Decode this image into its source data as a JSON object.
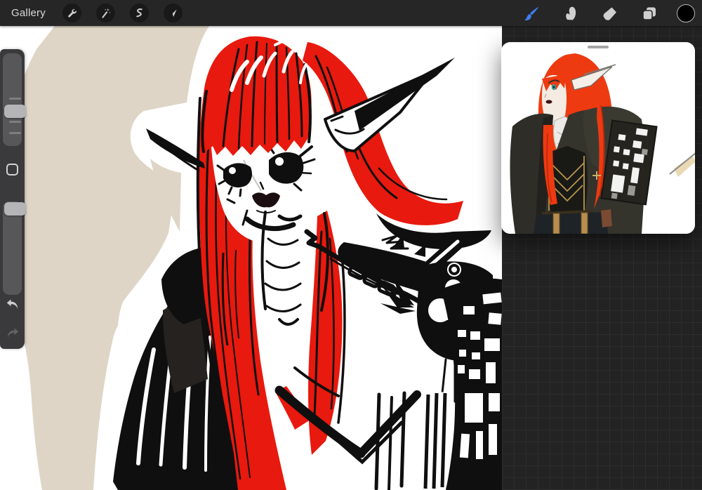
{
  "app_title": "Procreate canvas workspace",
  "toolbar": {
    "gallery_label": "Gallery",
    "left_tools": [
      {
        "id": "actions",
        "label": "Actions",
        "icon": "wrench-icon"
      },
      {
        "id": "adjustments",
        "label": "Adjustments",
        "icon": "magic-wand-icon"
      },
      {
        "id": "selection",
        "label": "Selection",
        "icon": "selection-s-icon"
      },
      {
        "id": "transform",
        "label": "Transform",
        "icon": "transform-arrow-icon"
      }
    ],
    "right_tools": [
      {
        "id": "paint",
        "label": "Paint",
        "icon": "brush-icon",
        "active": true
      },
      {
        "id": "smudge",
        "label": "Smudge",
        "icon": "smudge-icon",
        "active": false
      },
      {
        "id": "erase",
        "label": "Erase",
        "icon": "eraser-icon",
        "active": false
      },
      {
        "id": "layers",
        "label": "Layers",
        "icon": "layers-icon",
        "active": false
      },
      {
        "id": "color",
        "label": "Color",
        "icon": "color-circle-icon",
        "active": false,
        "current_color": "#000000"
      }
    ]
  },
  "sidebar": {
    "brush_size_slider": {
      "label": "Brush size",
      "handle_position": "middle"
    },
    "opacity_slider": {
      "label": "Opacity",
      "handle_position": "top"
    },
    "modify_button_label": "Modify",
    "undo_label": "Undo",
    "redo_label": "Redo"
  },
  "canvas": {
    "description": "Black, white and red ink sketch of a red-haired elf woman with long pointed ears, dark jacket, ruffled cravat, checkered shoulder armor and club-shaped tassel, over a beige brush wash",
    "artwork_labels": {
      "wash": "beige-brush-wash",
      "figure": "elf-character-sketch"
    }
  },
  "reference_panel": {
    "label": "Reference image",
    "content": "Colored concept art of the same red-haired elf in dark olive jacket with checkered pauldron, gold-trimmed corset and tan belts"
  },
  "colors": {
    "toolbar_bg": "#262626",
    "toolbar_button_bg": "#191919",
    "icon_gray": "#cfcfcf",
    "accent_blue": "#3f7ef0",
    "workspace_bg": "#232323",
    "grid_line": "#2d2d2d",
    "sidebar_bg": "#3a3a3c",
    "slider_track": "#57575a",
    "slider_handle": "#b5b5b7",
    "canvas_white": "#ffffff",
    "wash_beige": "#ded5c6",
    "ink_black": "#100f0f",
    "hair_red": "#e8190e",
    "ref_hair_red": "#ee3a11",
    "ref_jacket_olive": "#34332c",
    "ref_gold": "#b9964a",
    "teal_eye": "#3d9596",
    "current_color": "#000000"
  }
}
